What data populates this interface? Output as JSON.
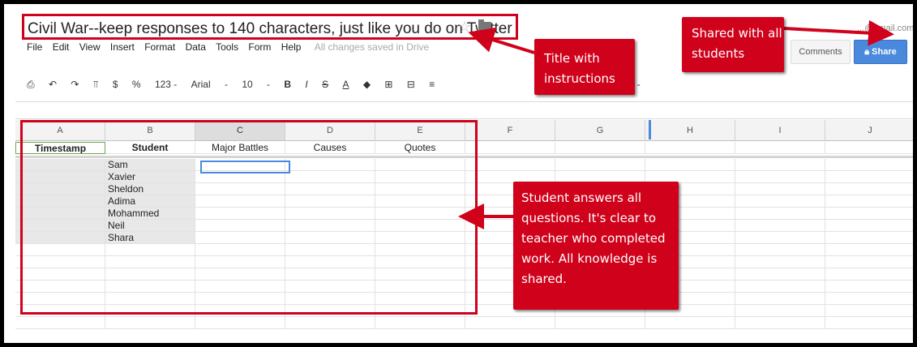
{
  "document": {
    "title": "Civil War--keep responses to 140 characters, just like you do on Twitter",
    "account_email": "...@gmail.com"
  },
  "menu": [
    "File",
    "Edit",
    "View",
    "Insert",
    "Format",
    "Data",
    "Tools",
    "Form",
    "Help"
  ],
  "save_status": "All changes saved in Drive",
  "buttons": {
    "comments": "Comments",
    "share": "Share"
  },
  "toolbar": {
    "currency": "$",
    "percent": "%",
    "number_format": "123 -",
    "font": "Arial",
    "font_dropdown": "-",
    "font_size": "10",
    "font_size_dropdown": "-",
    "bold": "B",
    "italic": "I",
    "strike": "S",
    "text_color": "A",
    "sum": "Σ -"
  },
  "columns": [
    "A",
    "B",
    "C",
    "D",
    "E",
    "F",
    "G",
    "H",
    "I",
    "J"
  ],
  "selected_column": "C",
  "header_row": [
    "Timestamp",
    "Student",
    "Major Battles",
    "Causes",
    "Quotes"
  ],
  "students": [
    "Sam",
    "Xavier",
    "Sheldon",
    "Adima",
    "Mohammed",
    "Neil",
    "Shara"
  ],
  "annotations": {
    "title": "Title with instructions",
    "shared": "Shared with all students",
    "answers": "Student answers all questions. It's clear to teacher who completed work. All knowledge is shared."
  },
  "colors": {
    "accent": "#d0021b",
    "share_blue": "#4a89dc"
  },
  "icons": [
    "star-icon",
    "folder-icon",
    "print-icon",
    "undo-icon",
    "redo-icon",
    "paint-format-icon",
    "lock-icon",
    "fill-color-icon",
    "borders-icon",
    "merge-icon",
    "align-icon"
  ]
}
